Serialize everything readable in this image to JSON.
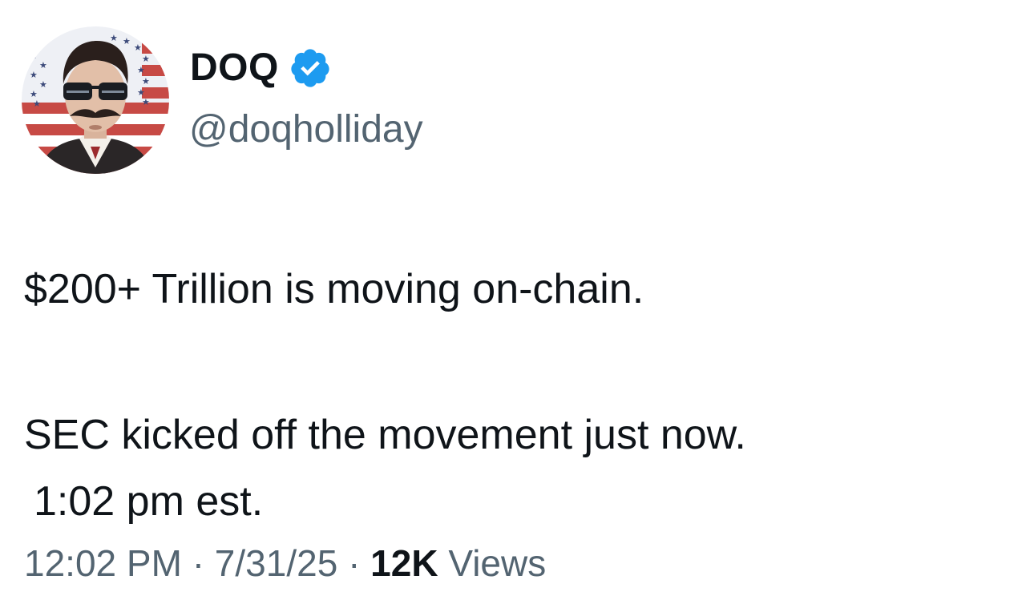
{
  "author": {
    "display_name": "DOQ",
    "handle": "@doqholliday",
    "verified_icon": "verified-badge-icon",
    "verified_color": "#1d9bf0"
  },
  "tweet": {
    "line1": "$200+ Trillion is moving on-chain.",
    "line2": "SEC kicked off the movement just now.",
    "line3": "1:02 pm est."
  },
  "meta": {
    "time": "12:02 PM",
    "separator": "·",
    "date": "7/31/25",
    "views_count": "12K",
    "views_label": "Views"
  },
  "colors": {
    "text_primary": "#0f1419",
    "text_secondary": "#536471"
  }
}
